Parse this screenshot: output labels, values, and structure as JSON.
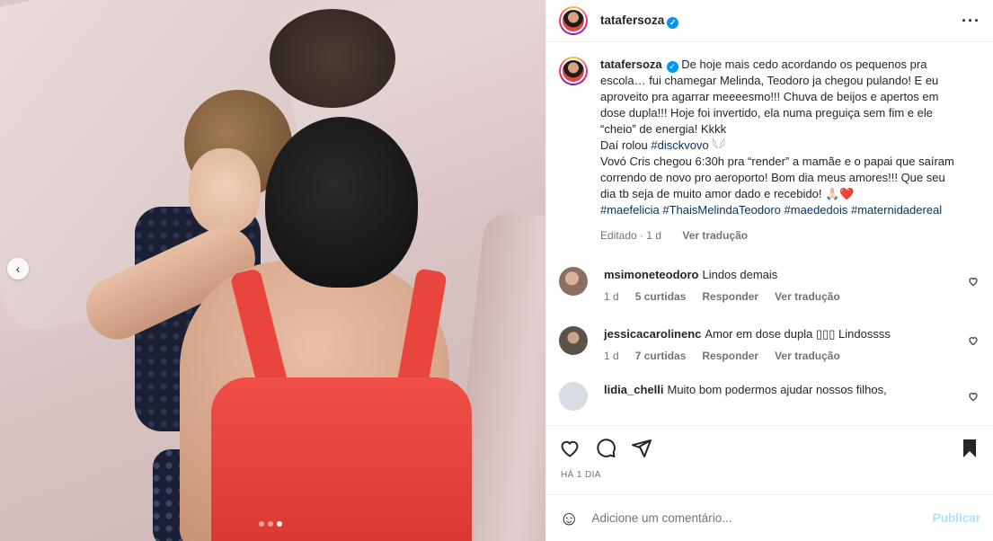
{
  "post": {
    "carousel": {
      "total": 3,
      "current": 3,
      "prev_glyph": "‹"
    },
    "author": {
      "username": "tatafersoza",
      "verified_glyph": "✓"
    },
    "more_glyph": "···",
    "caption": {
      "username": "tatafersoza",
      "lines": [
        "De hoje mais cedo acordando os pequenos pra escola… fui chamegar Melinda, Teodoro ja chegou pulando! E eu aproveito pra agarrar meeeesmo!!! Chuva de beijos e apertos em dose dupla!!! Hoje foi invertido, ela numa preguiça sem fim e ele “cheio” de energia! Kkkk",
        "Daí rolou",
        "#disckvovo",
        " 𓆩𓆪",
        "Vovó Cris chegou 6:30h pra “render” a mamãe e o papai que saíram correndo de novo pro aeroporto! Bom dia meus amores!!! Que seu dia tb seja de muito amor dado e recebido! 🙏🏻❤️"
      ],
      "hashtags": [
        "#maefelicia",
        "#ThaisMelindaTeodoro",
        "#maededois",
        "#maternidadereal"
      ],
      "edited": "Editado",
      "age": "1 d",
      "translate": "Ver tradução"
    },
    "comments": [
      {
        "username": "msimoneteodoro",
        "text": "Lindos demais",
        "age": "1 d",
        "likes": "5 curtidas",
        "reply": "Responder",
        "translate": "Ver tradução",
        "avatar_color": "#8a6f63"
      },
      {
        "username": "jessicacarolinenc",
        "text": "Amor em dose dupla ▯▯▯ Lindossss",
        "age": "1 d",
        "likes": "7 curtidas",
        "reply": "Responder",
        "translate": "Ver tradução",
        "avatar_color": "#5b5347"
      },
      {
        "username": "lidia_chelli",
        "text": "Muito bom podermos ajudar nossos filhos,",
        "avatar_color": "#d9dde3"
      }
    ],
    "timestamp": "HÁ 1 DIA",
    "add_comment": {
      "placeholder": "Adicione um comentário...",
      "publish": "Publicar",
      "emoji_glyph": "☺"
    }
  },
  "colors": {
    "accent": "#0095f6",
    "hashtag": "#00376b",
    "publish_disabled": "#b2dffc"
  }
}
